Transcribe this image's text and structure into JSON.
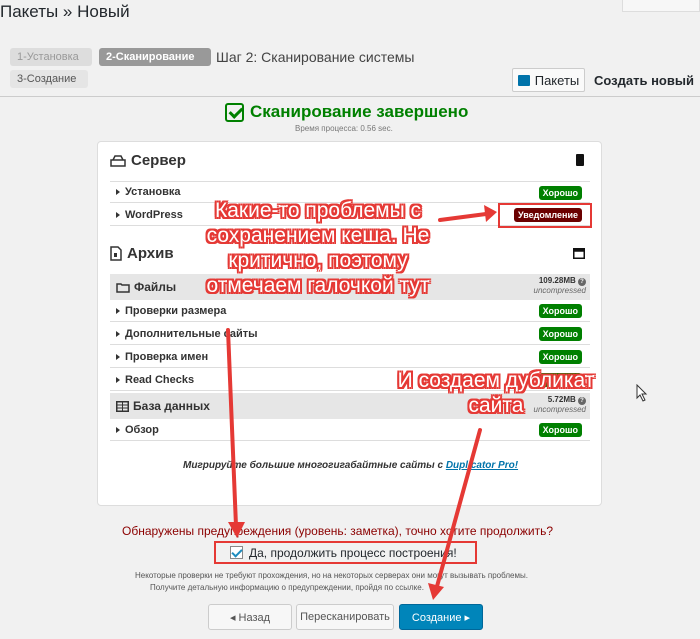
{
  "header": {
    "title": "Пакеты » Новый"
  },
  "steps": [
    {
      "label": "1-Установка"
    },
    {
      "label": "2-Сканирование"
    },
    {
      "label": "3-Создание"
    }
  ],
  "step_heading": "Шаг 2: Сканирование системы",
  "toolbar": {
    "packages_label": "Пакеты",
    "create_new_label": "Создать новый"
  },
  "scan": {
    "title": "Сканирование завершено",
    "time": "Время процесса: 0.56 sec."
  },
  "server": {
    "title": "Сервер",
    "rows": [
      {
        "label": "Установка",
        "status": "Хорошо"
      },
      {
        "label": "WordPress",
        "status": "Уведомление"
      }
    ]
  },
  "archive": {
    "title": "Архив",
    "files": {
      "title": "Файлы",
      "size": "109.28MB",
      "note": "uncompressed"
    },
    "file_rows": [
      {
        "label": "Проверки размера",
        "status": "Хорошо"
      },
      {
        "label": "Дополнительные сайты",
        "status": "Хорошо"
      },
      {
        "label": "Проверка имен",
        "status": "Хорошо"
      },
      {
        "label": "Read Checks",
        "status": "Хорошо"
      }
    ],
    "db": {
      "title": "База данных",
      "size": "5.72MB",
      "note": "uncompressed"
    },
    "db_rows": [
      {
        "label": "Обзор",
        "status": "Хорошо"
      }
    ]
  },
  "promo": {
    "text": "Мигрируйте большие многогигабайтные сайты с ",
    "link": "Duplicator Pro!"
  },
  "warning": {
    "text": "Обнаружены предупреждения (уровень: заметка), точно хотите продолжить?"
  },
  "confirm": {
    "label": "Да, продолжить процесс построения!"
  },
  "notes": {
    "line1": "Некоторые проверки не требуют прохождения, но на некоторых серверах они могут вызывать проблемы.",
    "line2": "Получите детальную информацию о предупреждении, пройдя по ссылке."
  },
  "buttons": {
    "back": "◂ Назад",
    "rescan": "Перескан­ировать",
    "create": "Создание ▸"
  },
  "annotations": {
    "a1_l1": "Какие-то проблемы с",
    "a1_l2": "сохранением кеша. Не",
    "a1_l3": "критично, поэтому",
    "a1_l4": "отмечаем галочкой тут",
    "a2_l1": "И создаем дубликат",
    "a2_l2": "сайта"
  },
  "colors": {
    "accent": "#0085ba",
    "good": "#008000",
    "warn": "#6b0000",
    "annotation": "#e53935"
  }
}
